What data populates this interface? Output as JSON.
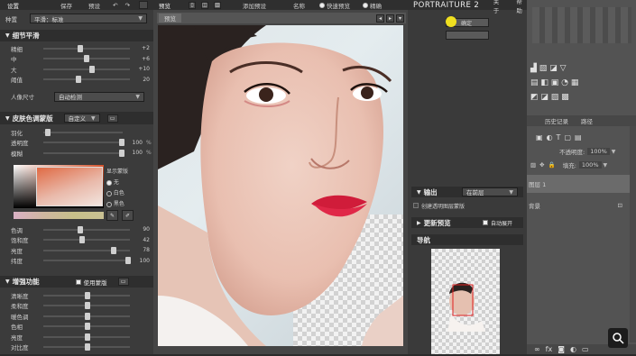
{
  "topbar": {
    "settings_label": "设置",
    "save_label": "保存",
    "preset_label": "预设",
    "preview_label": "预览",
    "add_preset_label": "添加预设",
    "name_label": "名称",
    "fast_preview_label": "快速预览",
    "precise_label": "精确",
    "about_label": "关于",
    "help_label": "帮助"
  },
  "preset_row": {
    "label": "种置",
    "value": "平滑：标准"
  },
  "detail_smoothing": {
    "title": "细节平滑",
    "rows": [
      {
        "label": "精细",
        "value": "+2"
      },
      {
        "label": "中",
        "value": "+6"
      },
      {
        "label": "大",
        "value": "+10"
      },
      {
        "label": "阈值",
        "value": "20"
      }
    ],
    "portrait_size_label": "人像尺寸",
    "portrait_size_value": "自动检测"
  },
  "skin_mask": {
    "title": "皮肤色调蒙版",
    "mode_value": "自定义",
    "rows": [
      {
        "label": "羽化",
        "value": ""
      },
      {
        "label": "透明度",
        "value": "100",
        "unit": "%"
      },
      {
        "label": "模糊",
        "value": "100",
        "unit": "%"
      }
    ],
    "show_mask_label": "显示蒙版",
    "options": [
      "无",
      "白色",
      "黑色"
    ],
    "hsl_rows": [
      {
        "label": "色调",
        "value": "90"
      },
      {
        "label": "饱和度",
        "value": "42"
      },
      {
        "label": "亮度",
        "value": "78"
      },
      {
        "label": "纬度",
        "value": "100"
      }
    ]
  },
  "enhance": {
    "title": "增强功能",
    "use_mask_label": "使用蒙版",
    "rows": [
      "清晰度",
      "柔和度",
      "暖色调",
      "色相",
      "亮度",
      "对比度"
    ]
  },
  "preview": {
    "tab_label": "预览"
  },
  "portraiture": {
    "brand": "PORTRAITURE",
    "version": "2",
    "ok_label": "确定",
    "output_label": "输出",
    "output_value": "在前层",
    "new_layer_label": "创建透明图层蒙版",
    "update_preview_label": "更新预览",
    "auto_expand_label": "自动展开",
    "navigator_label": "导航"
  },
  "photoshop": {
    "history_label": "历史记录",
    "paths_label": "路径",
    "opacity_label": "不透明度:",
    "opacity_value": "100%",
    "fill_label": "填充:",
    "fill_value": "100%",
    "layer1_name": "图层 1",
    "bg_layer_name": "背景"
  }
}
